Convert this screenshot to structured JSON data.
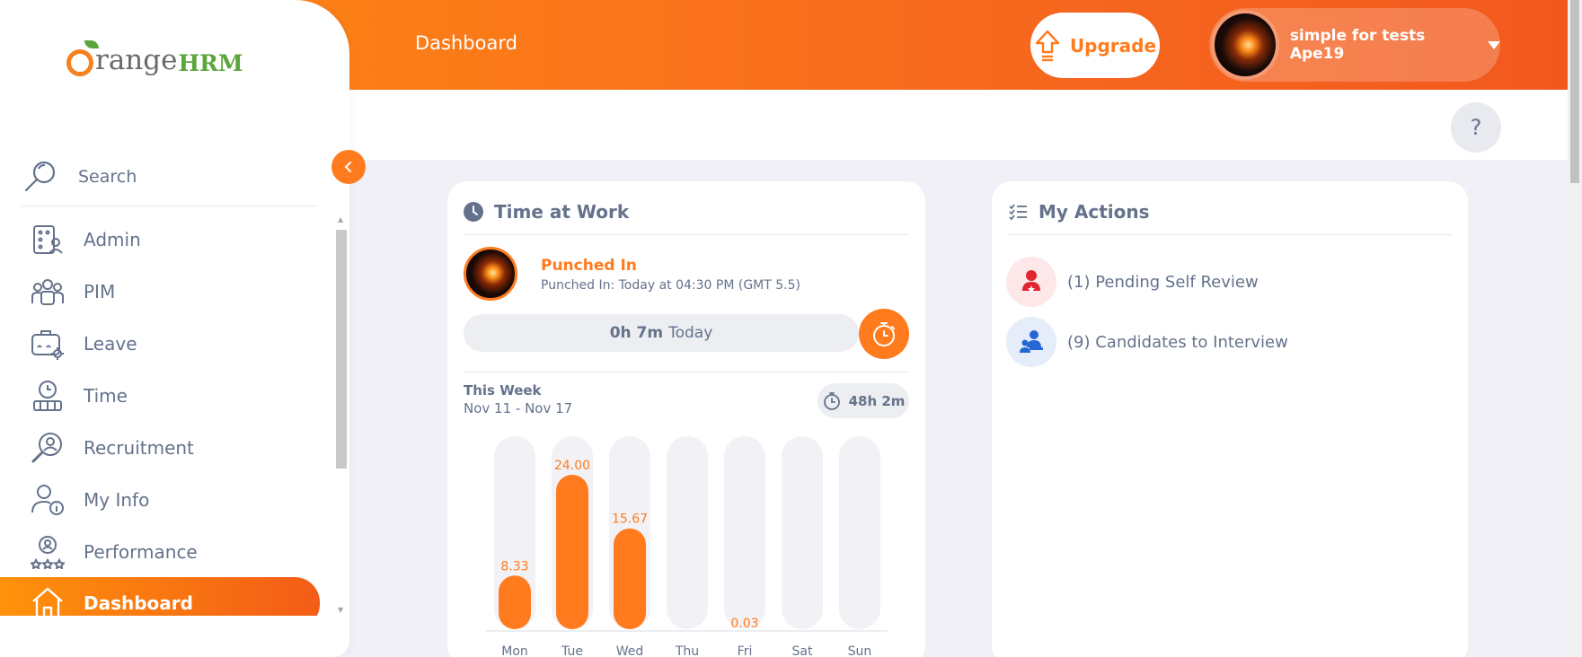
{
  "header": {
    "page_title": "Dashboard",
    "upgrade_label": "Upgrade",
    "user_name": "simple for tests Ape19"
  },
  "sidebar": {
    "logo_text_1": "range",
    "logo_text_2": "HRM",
    "search_label": "Search",
    "items": [
      {
        "label": "Admin",
        "icon": "admin-icon"
      },
      {
        "label": "PIM",
        "icon": "pim-icon"
      },
      {
        "label": "Leave",
        "icon": "leave-icon"
      },
      {
        "label": "Time",
        "icon": "time-icon"
      },
      {
        "label": "Recruitment",
        "icon": "recruitment-icon"
      },
      {
        "label": "My Info",
        "icon": "my-info-icon"
      },
      {
        "label": "Performance",
        "icon": "performance-icon"
      },
      {
        "label": "Dashboard",
        "icon": "dashboard-icon",
        "active": true
      }
    ]
  },
  "time_at_work": {
    "title": "Time at Work",
    "status": "Punched In",
    "punch_detail": "Punched In: Today at 04:30 PM (GMT 5.5)",
    "today_hours": "0h 7m",
    "today_label": "Today",
    "week_label": "This Week",
    "week_range": "Nov 11 - Nov 17",
    "week_total": "48h 2m"
  },
  "chart_data": {
    "type": "bar",
    "categories": [
      "Mon",
      "Tue",
      "Wed",
      "Thu",
      "Fri",
      "Sat",
      "Sun"
    ],
    "values": [
      8.33,
      24.0,
      15.67,
      null,
      0.03,
      null,
      null
    ],
    "labels": [
      "8.33",
      "24.00",
      "15.67",
      "",
      "0.03",
      "",
      ""
    ],
    "ylim": [
      0,
      30
    ],
    "bar_color": "#ff7b1d",
    "track_color": "#f2f2f6"
  },
  "my_actions": {
    "title": "My Actions",
    "items": [
      {
        "label": "(1) Pending Self Review",
        "color": "#e3252f",
        "bg": "#fde7e8"
      },
      {
        "label": "(9) Candidates to Interview",
        "color": "#2667d6",
        "bg": "#e5edfb"
      }
    ]
  },
  "help_label": "?",
  "colors": {
    "accent": "#ff7b1d",
    "text": "#64728c"
  }
}
